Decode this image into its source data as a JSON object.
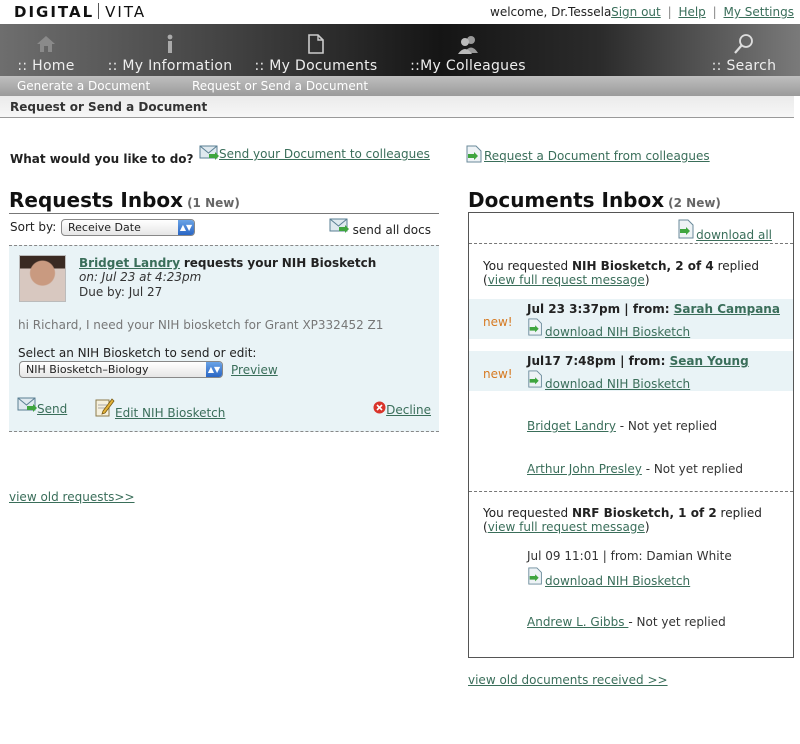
{
  "header": {
    "logo_left": "DIGITAL",
    "logo_right": "VITA",
    "welcome": "welcome, Dr.Tessela",
    "links": [
      "Sign out",
      "Help",
      "My Settings"
    ],
    "link_separator": "|"
  },
  "nav": {
    "items": [
      {
        "label": ":: Home",
        "icon": "home-icon"
      },
      {
        "label": ":: My Information",
        "icon": "info-icon"
      },
      {
        "label": ":: My Documents",
        "icon": "document-icon"
      },
      {
        "label": "::My Colleagues",
        "icon": "colleagues-icon"
      },
      {
        "label": ":: Search",
        "icon": "search-icon"
      }
    ],
    "subnav": [
      "Generate a Document",
      "Request or Send a Document"
    ]
  },
  "breadcrumb": "Request or Send a Document",
  "actions": {
    "prompt": "What would you like to do?",
    "send": "Send your Document to colleagues",
    "request": "Request a Document from colleagues"
  },
  "requests": {
    "title": "Requests Inbox",
    "count": "(1 New)",
    "sort_label": "Sort by:",
    "sort_value": "Receive Date",
    "send_all": "send all docs",
    "card": {
      "name": "Bridget Landry",
      "action": "requests your",
      "doc": "NIH Biosketch",
      "on": "on: Jul 23 at 4:23pm",
      "due": "Due by: Jul 27",
      "message": "hi Richard, I need your NIH biosketch for Grant XP332452 Z1",
      "select_label": "Select an NIH Biosketch to send or edit:",
      "select_value": "NIH Biosketch–Biology",
      "preview": "Preview",
      "send": "Send",
      "edit": "Edit NIH Biosketch",
      "decline": "Decline"
    },
    "old_link": "view old requests>>"
  },
  "documents": {
    "title": "Documents Inbox",
    "count": "(2 New)",
    "download_all": "download all",
    "groups": [
      {
        "prefix": "You requested",
        "doc": "NIH Biosketch, 2 of 4",
        "suffix": "replied",
        "view": "view full request message",
        "new_items": [
          {
            "tag": "new!",
            "date": "Jul 23 3:37pm | from:",
            "who": "Sarah Campana",
            "download": "download NIH Biosketch"
          },
          {
            "tag": "new!",
            "date": "Jul17 7:48pm | from:",
            "who": "Sean Young",
            "download": "download NIH Biosketch"
          }
        ],
        "pending": [
          {
            "name": "Bridget Landry",
            "status": " - Not yet replied"
          },
          {
            "name": "Arthur John Presley",
            "status": " - Not yet replied"
          }
        ]
      },
      {
        "prefix": "You requested",
        "doc": "NRF Biosketch, 1 of 2",
        "suffix": "replied",
        "view": "view full request message",
        "received": {
          "line": "Jul 09 11:01 | from: Damian White",
          "download": "download NIH Biosketch"
        },
        "pending": [
          {
            "name": "Andrew L. Gibbs ",
            "status": "- Not yet replied"
          }
        ]
      }
    ],
    "old_link": "view old documents received >>"
  },
  "colors": {
    "link": "#3a6e5a",
    "new_tag": "#d67a22",
    "card_bg": "#e9f3f6"
  }
}
